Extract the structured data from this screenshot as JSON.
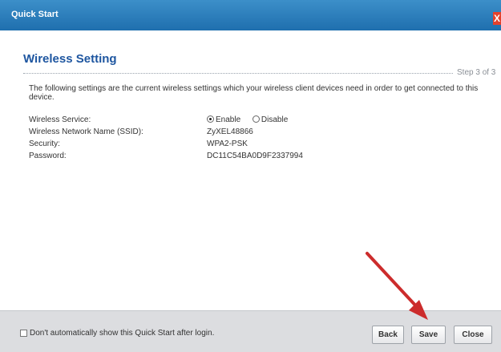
{
  "window": {
    "title": "Quick Start",
    "close_icon": "close-x-icon",
    "close_glyph": "X"
  },
  "page": {
    "heading": "Wireless Setting",
    "step": "Step 3 of 3"
  },
  "description": "The following settings are the current wireless settings which your wireless client devices need in order to get connected to this device.",
  "fields": {
    "service_label": "Wireless Service:",
    "service_options": [
      "Enable",
      "Disable"
    ],
    "service_selected": "Enable",
    "ssid_label": "Wireless Network Name (SSID):",
    "ssid_value": "ZyXEL48866",
    "security_label": "Security:",
    "security_value": "WPA2-PSK",
    "password_label": "Password:",
    "password_value": "DC11C54BA0D9F2337994"
  },
  "footer": {
    "checkbox_label": "Don't automatically show this Quick Start after login.",
    "checkbox_checked": false,
    "back_label": "Back",
    "save_label": "Save",
    "close_label": "Close"
  },
  "colors": {
    "titlebar": "#1f6fae",
    "heading": "#1e56a0",
    "close_button": "#e4412c",
    "annotation_arrow": "#cc2c2c"
  }
}
